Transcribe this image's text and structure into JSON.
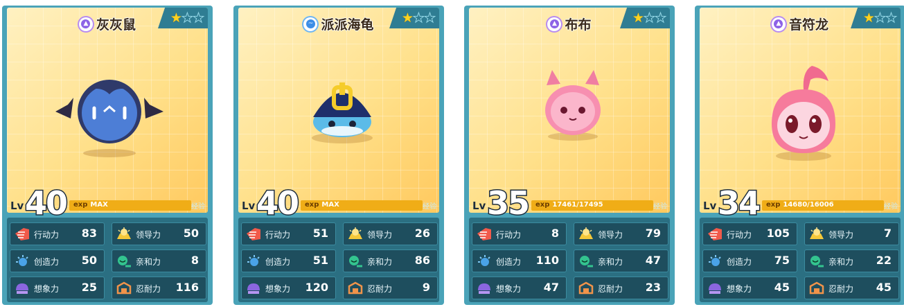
{
  "stat_labels": {
    "action": "行动力",
    "creation": "创造力",
    "imagination": "想象力",
    "leadership": "领导力",
    "affinity": "亲和力",
    "endurance": "忍耐力"
  },
  "lv_label": "Lv",
  "exp_label": "exp",
  "jingyan_label": "经验",
  "colors": {
    "accent_gold": "#f0ad17",
    "card_teal": "#4aa3b8",
    "stat_bg": "#1e4e5e"
  },
  "cards": [
    {
      "name": "灰灰鼠",
      "element_icon": "dark-element-icon",
      "stars": 1,
      "max_stars": 3,
      "level": "40",
      "exp": "MAX",
      "exp_fill": 1.0,
      "stats": {
        "action": "83",
        "leadership": "50",
        "creation": "50",
        "affinity": "8",
        "imagination": "25",
        "endurance": "116"
      }
    },
    {
      "name": "派派海龟",
      "element_icon": "water-element-icon",
      "stars": 1,
      "max_stars": 3,
      "level": "40",
      "exp": "MAX",
      "exp_fill": 1.0,
      "stats": {
        "action": "51",
        "leadership": "26",
        "creation": "51",
        "affinity": "86",
        "imagination": "120",
        "endurance": "9"
      }
    },
    {
      "name": "布布",
      "element_icon": "dark-element-icon",
      "stars": 1,
      "max_stars": 3,
      "level": "35",
      "exp": "17461/17495",
      "exp_fill": 0.998,
      "stats": {
        "action": "8",
        "leadership": "79",
        "creation": "110",
        "affinity": "47",
        "imagination": "47",
        "endurance": "23"
      }
    },
    {
      "name": "音符龙",
      "element_icon": "dark-element-icon",
      "stars": 1,
      "max_stars": 3,
      "level": "34",
      "exp": "14680/16006",
      "exp_fill": 0.917,
      "stats": {
        "action": "105",
        "leadership": "7",
        "creation": "75",
        "affinity": "22",
        "imagination": "45",
        "endurance": "45"
      }
    }
  ]
}
